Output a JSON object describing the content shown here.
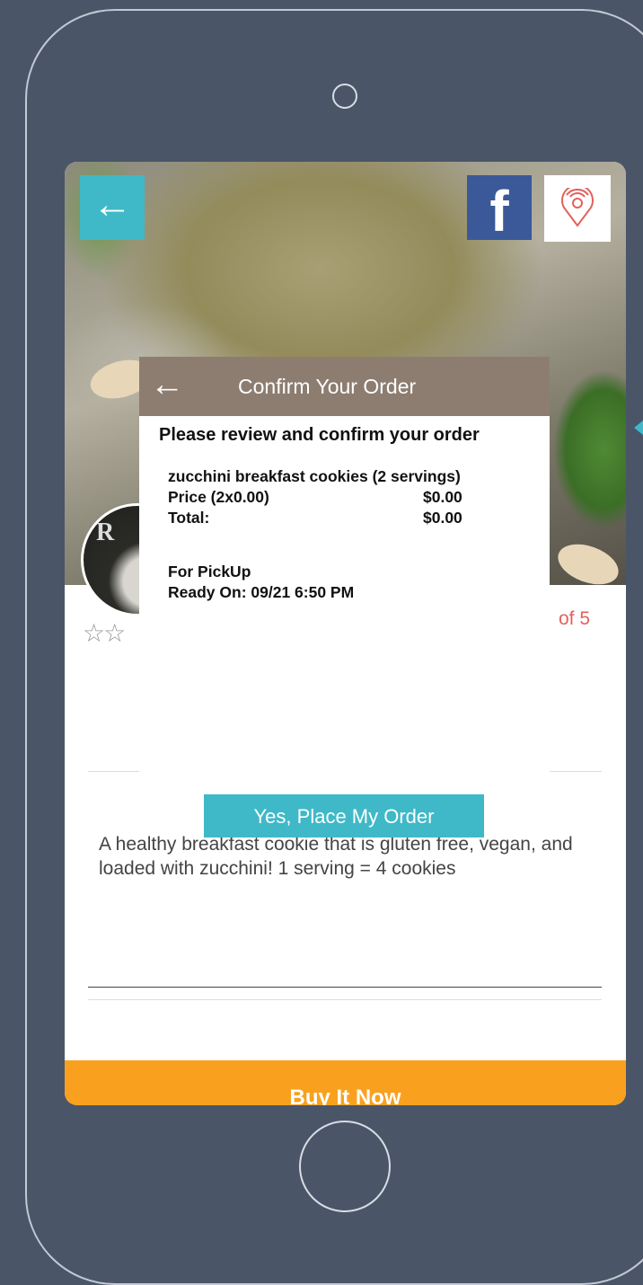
{
  "hero": {
    "back_icon": "arrow-left-icon",
    "facebook_label": "f",
    "location_icon": "location-pin-icon"
  },
  "product": {
    "avatar_text": "R",
    "rating_text": "of 5",
    "description": "A healthy breakfast cookie that is gluten free, vegan, and loaded with zucchini! 1 serving = 4 cookies",
    "buy_label": "Buy It Now"
  },
  "modal": {
    "title": "Confirm Your Order",
    "intro": "Please review and confirm your order",
    "item": "zucchini breakfast cookies (2 servings)",
    "price_label": "Price (2x0.00)",
    "price_value": "$0.00",
    "total_label": "Total:",
    "total_value": "$0.00",
    "fulfillment": "For PickUp",
    "ready_on": "Ready On: 09/21 6:50 PM",
    "confirm_label": "Yes, Place My Order"
  },
  "colors": {
    "teal": "#3fb9c8",
    "facebook": "#3b5998",
    "modal_header": "#8d7d71",
    "buy_bar": "#f9a11e",
    "rating": "#e4605b",
    "device_bg": "#4a5568"
  }
}
